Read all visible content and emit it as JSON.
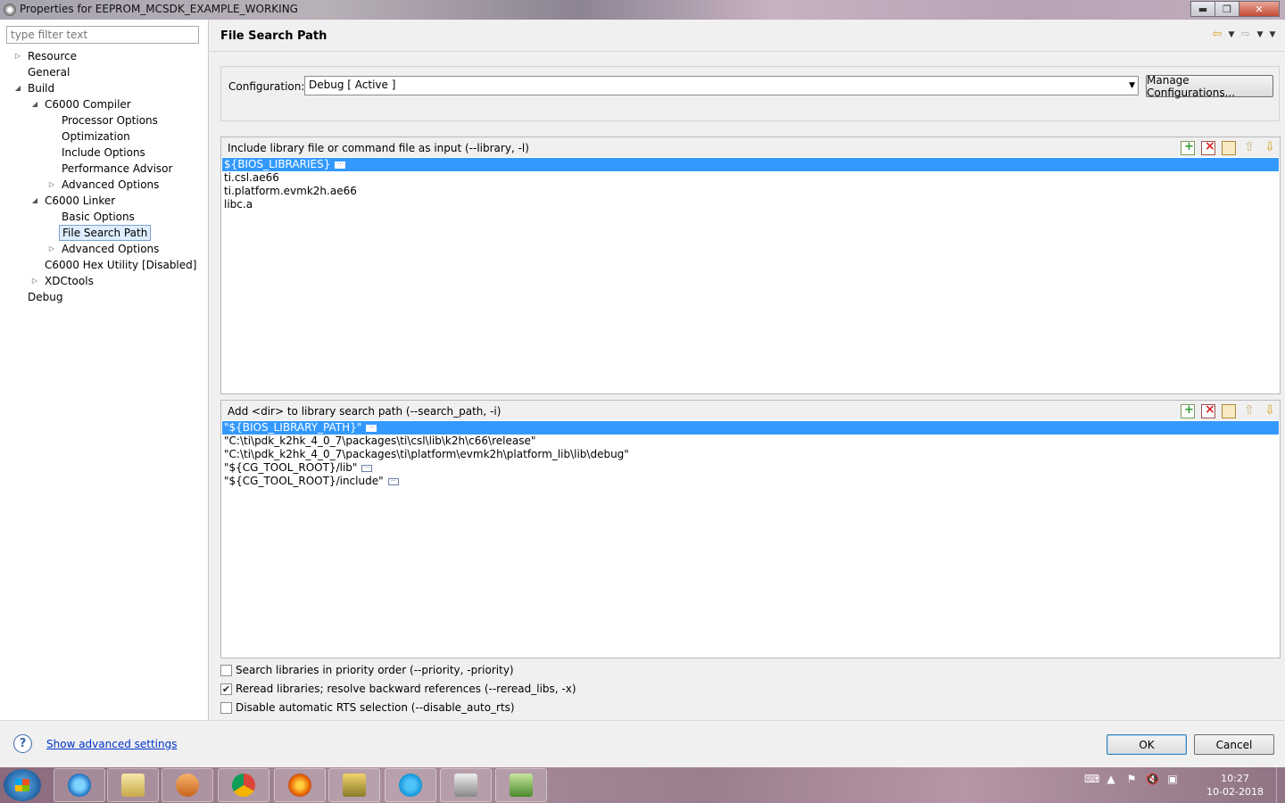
{
  "window": {
    "title": "Properties for EEPROM_MCSDK_EXAMPLE_WORKING",
    "controls": {
      "minimize": "▬",
      "maximize": "❐",
      "close": "✕"
    }
  },
  "sidebar": {
    "filter_placeholder": "type filter text",
    "tree": [
      {
        "label": "Resource",
        "level": 0,
        "toggle": "▷"
      },
      {
        "label": "General",
        "level": 0,
        "toggle": ""
      },
      {
        "label": "Build",
        "level": 0,
        "toggle": "◢"
      },
      {
        "label": "C6000 Compiler",
        "level": 1,
        "toggle": "◢"
      },
      {
        "label": "Processor Options",
        "level": 2,
        "toggle": ""
      },
      {
        "label": "Optimization",
        "level": 2,
        "toggle": ""
      },
      {
        "label": "Include Options",
        "level": 2,
        "toggle": ""
      },
      {
        "label": "Performance Advisor",
        "level": 2,
        "toggle": ""
      },
      {
        "label": "Advanced Options",
        "level": 2,
        "toggle": "▷"
      },
      {
        "label": "C6000 Linker",
        "level": 1,
        "toggle": "◢"
      },
      {
        "label": "Basic Options",
        "level": 2,
        "toggle": ""
      },
      {
        "label": "File Search Path",
        "level": 2,
        "toggle": "",
        "selected": true
      },
      {
        "label": "Advanced Options",
        "level": 2,
        "toggle": "▷"
      },
      {
        "label": "C6000 Hex Utility  [Disabled]",
        "level": 1,
        "toggle": ""
      },
      {
        "label": "XDCtools",
        "level": 1,
        "toggle": "▷"
      },
      {
        "label": "Debug",
        "level": 0,
        "toggle": ""
      }
    ]
  },
  "page": {
    "title": "File Search Path",
    "nav": {
      "back": "⇦",
      "forward": "⇨",
      "dropdown": "▼",
      "menu": "▼"
    }
  },
  "configuration": {
    "label": "Configuration:",
    "value": "Debug  [ Active ]",
    "manage_button": "Manage Configurations..."
  },
  "library_group": {
    "title": "Include library file or command file as input (--library, -l)",
    "items": [
      {
        "text": "${BIOS_LIBRARIES}",
        "ellipsis": true,
        "selected": true
      },
      {
        "text": "ti.csl.ae66",
        "ellipsis": false,
        "selected": false
      },
      {
        "text": "ti.platform.evmk2h.ae66",
        "ellipsis": false,
        "selected": false
      },
      {
        "text": "libc.a",
        "ellipsis": false,
        "selected": false
      }
    ]
  },
  "search_path_group": {
    "title": "Add <dir> to library search path (--search_path, -i)",
    "items": [
      {
        "text": "\"${BIOS_LIBRARY_PATH}\"",
        "ellipsis": true,
        "selected": true
      },
      {
        "text": "\"C:\\ti\\pdk_k2hk_4_0_7\\packages\\ti\\csl\\lib\\k2h\\c66\\release\"",
        "ellipsis": false,
        "selected": false
      },
      {
        "text": "\"C:\\ti\\pdk_k2hk_4_0_7\\packages\\ti\\platform\\evmk2h\\platform_lib\\lib\\debug\"",
        "ellipsis": false,
        "selected": false
      },
      {
        "text": "\"${CG_TOOL_ROOT}/lib\"",
        "ellipsis": true,
        "selected": false
      },
      {
        "text": "\"${CG_TOOL_ROOT}/include\"",
        "ellipsis": true,
        "selected": false
      }
    ]
  },
  "tool_icons": [
    "add-icon",
    "delete-icon",
    "edit-icon",
    "move-up-icon",
    "move-down-icon"
  ],
  "ellipsis_glyph": "···",
  "checkboxes": [
    {
      "label": "Search libraries in priority order (--priority, -priority)",
      "checked": false
    },
    {
      "label": "Reread libraries; resolve backward references (--reread_libs, -x)",
      "checked": true
    },
    {
      "label": "Disable automatic RTS selection (--disable_auto_rts)",
      "checked": false
    }
  ],
  "footer": {
    "help_glyph": "?",
    "advanced_link": "Show advanced settings",
    "ok": "OK",
    "cancel": "Cancel"
  },
  "taskbar": {
    "apps": [
      "internet-explorer-icon",
      "file-explorer-icon",
      "media-player-icon",
      "chrome-icon",
      "firefox-icon",
      "notepad-icon",
      "skype-icon",
      "ccs-cube-icon",
      "code-composer-icon"
    ],
    "time": "10:27",
    "date": "10-02-2018"
  },
  "colors": {
    "selection": "#3399ff",
    "link": "#0033cc"
  }
}
